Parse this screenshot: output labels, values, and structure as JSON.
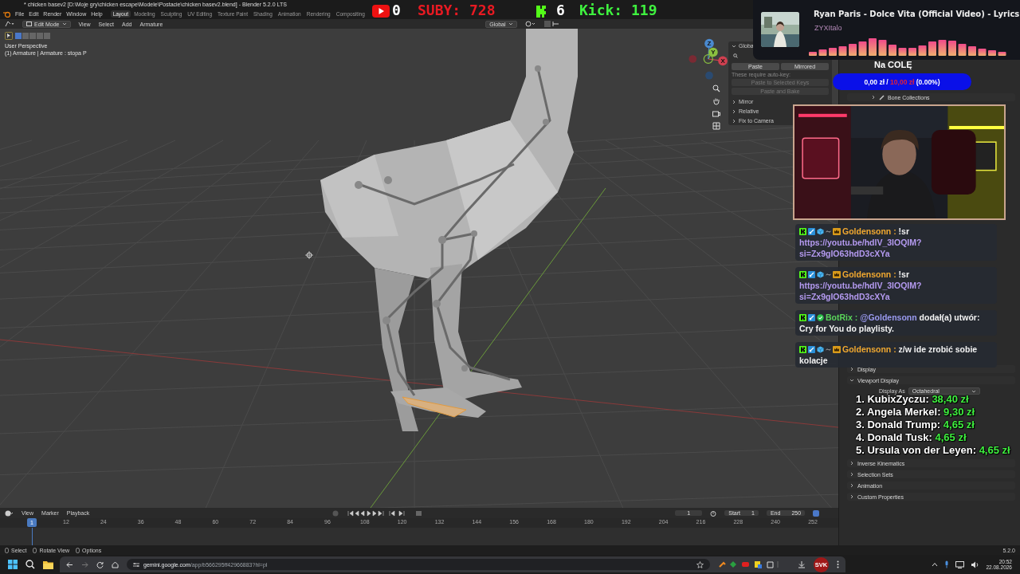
{
  "window": {
    "title": "* chicken basev2 [D:\\Moje gry\\chicken escape\\Modele\\Postacie\\chicken basev2.blend] - Blender 5.2.0 LTS"
  },
  "menu": [
    "File",
    "Edit",
    "Render",
    "Window",
    "Help"
  ],
  "workspaces": [
    {
      "label": "Layout",
      "selected": true
    },
    {
      "label": "Modeling",
      "selected": false
    },
    {
      "label": "Sculpting",
      "selected": false
    },
    {
      "label": "UV Editing",
      "selected": false
    },
    {
      "label": "Texture Paint",
      "selected": false
    },
    {
      "label": "Shading",
      "selected": false
    },
    {
      "label": "Animation",
      "selected": false
    },
    {
      "label": "Rendering",
      "selected": false
    },
    {
      "label": "Compositing",
      "selected": false
    }
  ],
  "header": {
    "mode": "Edit Mode",
    "menus": [
      "View",
      "Select",
      "Add",
      "Armature"
    ],
    "orientation": "Global"
  },
  "viewport": {
    "perspective": "User Perspective",
    "object": "(1) Armature | Armature : stopa P",
    "gizmo_axes": [
      "Z",
      "Y",
      "X"
    ]
  },
  "sidebar": {
    "header": "Globa",
    "buttons": [
      {
        "label": "Paste",
        "disabled": false
      },
      {
        "label": "Mirrored",
        "disabled": false
      }
    ],
    "note": "These require auto-key:",
    "actions": [
      {
        "label": "Paste to Selected Keys",
        "disabled": true
      },
      {
        "label": "Paste and Bake",
        "disabled": true
      }
    ],
    "panels": [
      {
        "label": "Mirror",
        "expanded": false
      },
      {
        "label": "Relative",
        "expanded": false
      },
      {
        "label": "Fix to Camera",
        "expanded": false
      }
    ]
  },
  "properties": {
    "bone_collections": "Bone Collections",
    "display": {
      "label": "Display",
      "expanded": false
    },
    "viewport_display": {
      "label": "Viewport Display",
      "expanded": true,
      "display_as_label": "Display As",
      "display_as": "Octahedral"
    },
    "sections": [
      {
        "label": "Inverse Kinematics",
        "expanded": false
      },
      {
        "label": "Selection Sets",
        "expanded": false
      },
      {
        "label": "Animation",
        "expanded": false
      },
      {
        "label": "Custom Properties",
        "expanded": false
      }
    ]
  },
  "timeline": {
    "menus": [
      "View",
      "Marker",
      "Playback"
    ],
    "current_frame": "1",
    "start_label": "Start",
    "start": "1",
    "end_label": "End",
    "end": "250",
    "playhead": "1",
    "ticks": [
      "12",
      "24",
      "36",
      "48",
      "60",
      "72",
      "84",
      "96",
      "108",
      "120",
      "132",
      "144",
      "156",
      "168",
      "180",
      "192",
      "204",
      "216",
      "228",
      "240",
      "252"
    ]
  },
  "status_bar": {
    "hints": [
      "Select",
      "Rotate View",
      "Options"
    ],
    "version": "5.2.0"
  },
  "taskbar": {
    "url_host": "gemini.google.com",
    "url_path": "/app/b566295ff42966883?hl=pl",
    "avatar": "SVK",
    "time": "20:52",
    "date": "22.08.2026"
  },
  "stream": {
    "youtube_count": "0",
    "subs": "SUBY: 728",
    "kick_count": "6",
    "kick": "Kick: 119",
    "song": {
      "title": "Ryan Paris - Dolce Vita (Official Video) - Lyrics",
      "artist": "ZYXItalo"
    },
    "goal": {
      "title": "Na COLĘ",
      "current": "0,00 zł /",
      "target": "10,00 zł",
      "percent": "(0.00%)",
      "level": 0
    },
    "chat": [
      {
        "user": "Goldensonn :",
        "color": "#f0a830",
        "badges": [
          {
            "kind": "kick"
          },
          {
            "kind": "sword"
          },
          {
            "kind": "cube"
          },
          {
            "kind": "tilde"
          },
          {
            "kind": "crown"
          }
        ],
        "parts": [
          {
            "kind": "text",
            "text": "!sr"
          },
          {
            "kind": "url",
            "text": "https://youtu.be/hdlV_3IOQIM?si=Zx9gIO63hdD3cXYa"
          }
        ]
      },
      {
        "user": "Goldensonn :",
        "color": "#f0a830",
        "badges": [
          {
            "kind": "kick"
          },
          {
            "kind": "sword"
          },
          {
            "kind": "cube"
          },
          {
            "kind": "tilde"
          },
          {
            "kind": "crown"
          }
        ],
        "parts": [
          {
            "kind": "text",
            "text": "!sr"
          },
          {
            "kind": "url",
            "text": "https://youtu.be/hdlV_3IOQIM?si=Zx9gIO63hdD3cXYa"
          }
        ]
      },
      {
        "user": "BotRix :",
        "color": "#5ad45a",
        "badges": [
          {
            "kind": "kick"
          },
          {
            "kind": "sword"
          },
          {
            "kind": "check"
          }
        ],
        "parts": [
          {
            "kind": "mention",
            "text": "@Goldensonn"
          },
          {
            "kind": "text",
            "text": "dodał(a) utwór: Cry for You do playlisty."
          }
        ]
      },
      {
        "user": "Goldensonn :",
        "color": "#f0a830",
        "badges": [
          {
            "kind": "kick"
          },
          {
            "kind": "sword"
          },
          {
            "kind": "cube"
          },
          {
            "kind": "tilde"
          },
          {
            "kind": "crown"
          }
        ],
        "parts": [
          {
            "kind": "text",
            "text": "z/w ide zrobić sobie kolacje"
          }
        ]
      }
    ],
    "donations": [
      {
        "rank": "1.",
        "name": "KubixZyczu:",
        "amount": "38,40 zł"
      },
      {
        "rank": "2.",
        "name": "Angela Merkel:",
        "amount": "9,30 zł"
      },
      {
        "rank": "3.",
        "name": "Donald Trump:",
        "amount": "4,65 zł"
      },
      {
        "rank": "4.",
        "name": "Donald Tusk:",
        "amount": "4,65 zł"
      },
      {
        "rank": "5.",
        "name": "Ursula von der Leyen:",
        "amount": "4,65 zł"
      }
    ]
  }
}
